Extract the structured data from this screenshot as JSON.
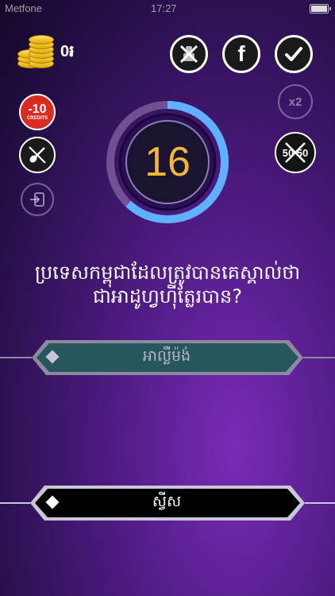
{
  "status": {
    "carrier": "Metfone",
    "time": "17:27"
  },
  "wallet": {
    "balance": "0៛",
    "icon": "coins-icon"
  },
  "top_buttons": [
    {
      "name": "ask-audience-icon"
    },
    {
      "name": "facebook-icon",
      "label": "f"
    },
    {
      "name": "checkmark-icon"
    }
  ],
  "left_tools": [
    {
      "name": "minus-10-credits-badge",
      "top": "-10",
      "bottom": "CREDITS"
    },
    {
      "name": "guitar-icon"
    },
    {
      "name": "exit-icon"
    }
  ],
  "right_tools": [
    {
      "name": "double-points-button",
      "label": "x2"
    },
    {
      "name": "fifty-fifty-button",
      "label": "50 50"
    }
  ],
  "timer": {
    "value": "16",
    "ring_progress": 0.62
  },
  "question": "ប្រទេសកម្ពុជាដែលត្រូវបានគេស្គាល់ថាជាអាដូហ្វហ៊ីត្លែរបាន?",
  "answers": [
    {
      "text": "អាល្លឺម៉ង់",
      "state": "selected"
    },
    {
      "text": "ស្វីស",
      "state": "normal"
    }
  ],
  "colors": {
    "accent": "#f2b63a",
    "ring": "#5fb0ff",
    "selected_fill": "#25575c"
  }
}
